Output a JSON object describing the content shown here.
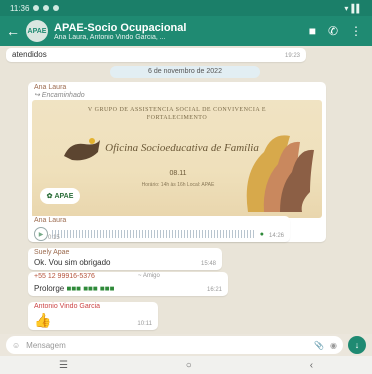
{
  "statusbar": {
    "time": "11:36",
    "signal": "▾▐ ▌"
  },
  "header": {
    "back": "←",
    "avatar": "APAE",
    "title": "APAE-Socio Ocupacional",
    "subtitle": "Ana Laura, Antonio Vindo Garcia, ...",
    "icons": {
      "video": "■",
      "call": "✆",
      "menu": "⋮"
    }
  },
  "chat": {
    "prev_text": "atendidos",
    "prev_time": "19:23",
    "date_pill": "6 de novembro de 2022",
    "flyer_msg": {
      "sender": "Ana Laura",
      "forwarded": "↪ Encaminhado",
      "flyer": {
        "header_lines": "V GRUPO DE ASSISTENCIA SOCIAL DE CONVIVENCIA E FORTALECIMENTO",
        "script": "Oficina Socioeducativa de Família",
        "date": "08.11",
        "info": "Horário: 14h às 16h  Local: APAE",
        "logo": "APAE"
      }
    },
    "audio_msg": {
      "sender": "Ana Laura",
      "duration": "0:15",
      "time": "14:26"
    },
    "reply_msg": {
      "sender": "Suely Apae",
      "text": "Ok. Vou sim obrigado",
      "time": "15:48"
    },
    "contact_msg": {
      "phone": "+55 12 99916-5376",
      "reactions": "~ Amigo",
      "text": "Prolorge",
      "time": "16:21"
    },
    "last_msg": {
      "sender": "Antonio Vindo Garcia",
      "emoji": "👍",
      "time": "10:11"
    }
  },
  "input": {
    "emoji": "☺",
    "placeholder": "Mensagem",
    "attach": "📎",
    "camera": "◉",
    "mic": "↓"
  },
  "nav": {
    "recent": "☰",
    "home": "○",
    "back": "‹"
  }
}
